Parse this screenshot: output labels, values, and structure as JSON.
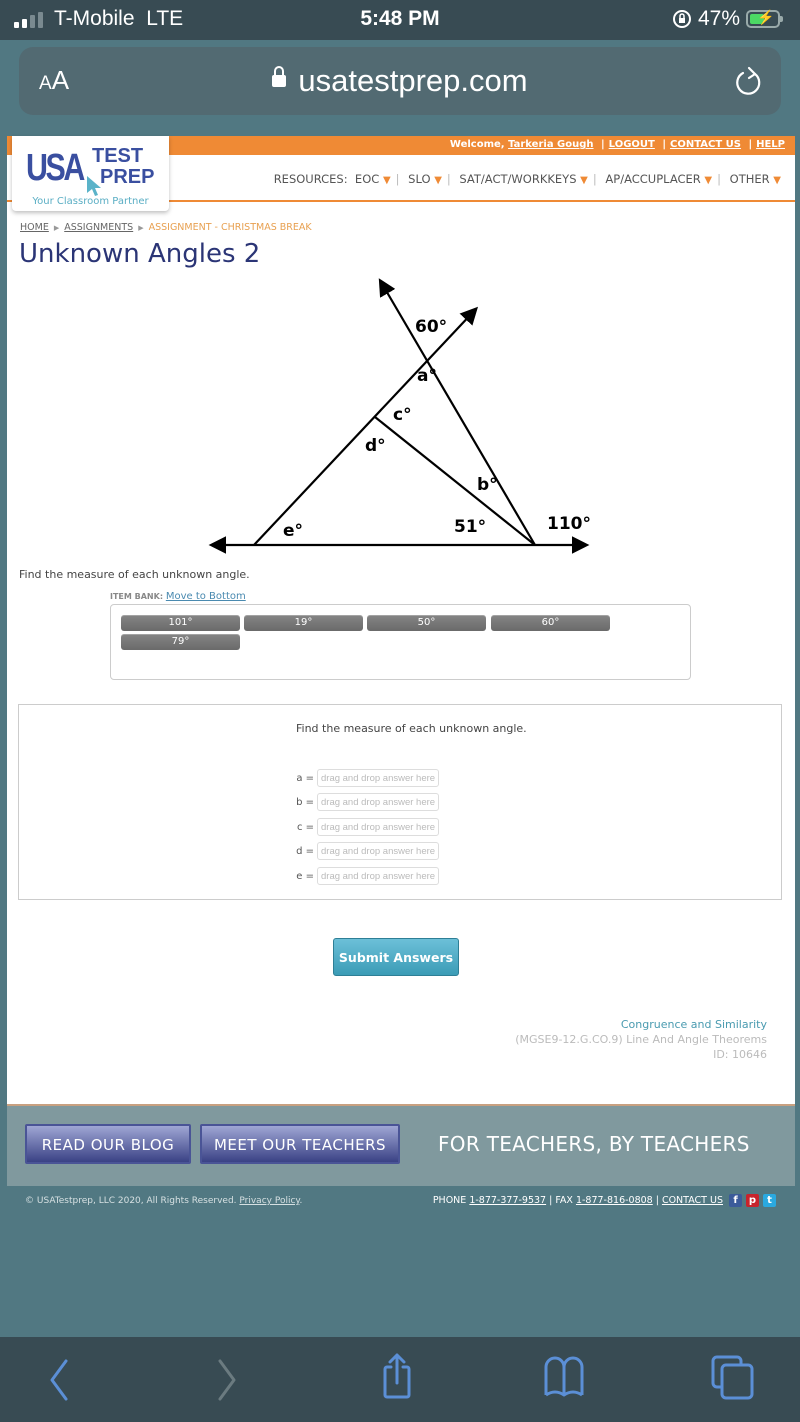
{
  "status_bar": {
    "carrier": "T-Mobile",
    "network": "LTE",
    "time": "5:48 PM",
    "battery": "47%",
    "battery_level": 0.47
  },
  "browser": {
    "text_size_label": "AA",
    "url": "usatestprep.com"
  },
  "header": {
    "welcome_prefix": "Welcome,",
    "user_name": "Tarkeria Gough",
    "links": [
      "LOGOUT",
      "CONTACT US",
      "HELP"
    ],
    "logo": {
      "usa": "USA",
      "test": "TEST",
      "prep": "PREP",
      "tagline": "Your Classroom Partner"
    },
    "resources_label": "RESOURCES:",
    "resource_menus": [
      "EOC",
      "SLO",
      "SAT/ACT/WORKKEYS",
      "AP/ACCUPLACER",
      "OTHER"
    ]
  },
  "breadcrumb": {
    "items": [
      "HOME",
      "ASSIGNMENTS"
    ],
    "current": "ASSIGNMENT - CHRISTMAS BREAK"
  },
  "page_title": "Unknown Angles 2",
  "diagram": {
    "labels": {
      "top": "60°",
      "a": "a°",
      "c": "c°",
      "d": "d°",
      "b": "b°",
      "e": "e°",
      "bottom_inner": "51°",
      "bottom_outer": "110°"
    }
  },
  "question": {
    "prompt": "Find the measure of each unknown angle.",
    "item_bank_label": "ITEM BANK:",
    "item_bank_link": "Move to Bottom",
    "item_bank": [
      "101°",
      "19°",
      "50°",
      "60°",
      "79°"
    ],
    "answer_prompt": "Find the measure of each unknown angle.",
    "answers": [
      {
        "label": "a =",
        "placeholder": "drag and drop answer here"
      },
      {
        "label": "b =",
        "placeholder": "drag and drop answer here"
      },
      {
        "label": "c =",
        "placeholder": "drag and drop answer here"
      },
      {
        "label": "d =",
        "placeholder": "drag and drop answer here"
      },
      {
        "label": "e =",
        "placeholder": "drag and drop answer here"
      }
    ],
    "submit_label": "Submit Answers"
  },
  "meta": {
    "category": "Congruence and Similarity",
    "standard": "(MGSE9-12.G.CO.9) Line And Angle Theorems",
    "id": "ID: 10646"
  },
  "footer": {
    "blog_button": "READ OUR BLOG",
    "teachers_button": "MEET OUR TEACHERS",
    "tagline": "FOR TEACHERS, BY TEACHERS",
    "copyright": "© USATestprep, LLC 2020, All Rights Reserved.",
    "privacy_link": "Privacy Policy",
    "phone_label": "PHONE",
    "phone": "1-877-377-9537",
    "fax_label": "FAX",
    "fax": "1-877-816-0808",
    "contact_link": "CONTACT US",
    "social": [
      "facebook",
      "pinterest",
      "twitter"
    ]
  },
  "colors": {
    "brand_orange": "#ef8a35",
    "brand_navy": "#2b3576",
    "accent_teal": "#4a9bb0",
    "ios_blue": "#5b8fd6"
  }
}
